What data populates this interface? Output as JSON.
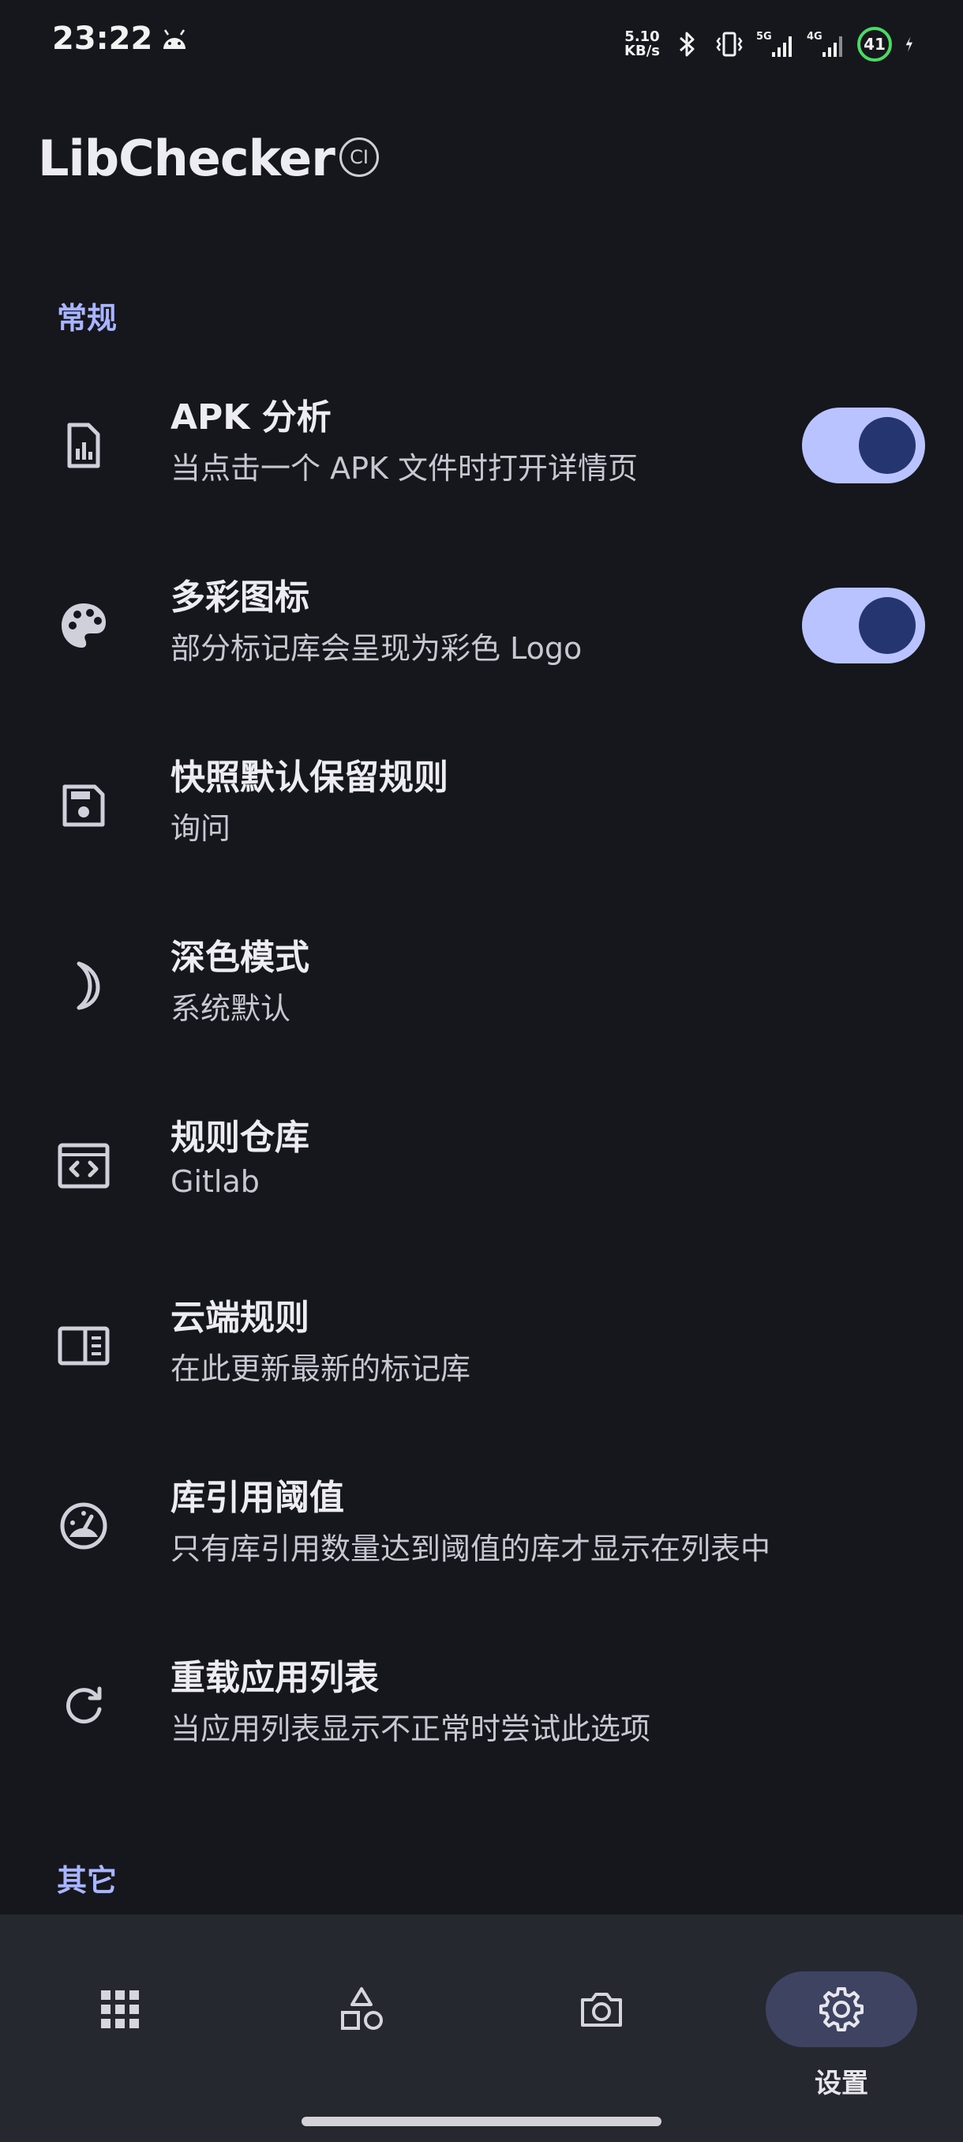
{
  "status_bar": {
    "time": "23:22",
    "net_speed_value": "5.10",
    "net_speed_unit": "KB/s",
    "battery": "41",
    "icons": [
      "android-icon",
      "bluetooth-icon",
      "vibrate-icon",
      "signal-5g-icon",
      "signal-4g-icon",
      "charging-icon"
    ]
  },
  "app_bar": {
    "title": "LibChecker",
    "badge": "CI"
  },
  "sections": {
    "general": "常规",
    "other": "其它"
  },
  "settings": [
    {
      "title": "APK 分析",
      "summary": "当点击一个 APK 文件时打开详情页",
      "icon": "file-chart-icon",
      "toggle": true
    },
    {
      "title": "多彩图标",
      "summary": "部分标记库会呈现为彩色 Logo",
      "icon": "palette-icon",
      "toggle": true
    },
    {
      "title": "快照默认保留规则",
      "summary": "询问",
      "icon": "save-icon"
    },
    {
      "title": "深色模式",
      "summary": "系统默认",
      "icon": "moon-icon"
    },
    {
      "title": "规则仓库",
      "summary": "Gitlab",
      "icon": "code-window-icon"
    },
    {
      "title": "云端规则",
      "summary": "在此更新最新的标记库",
      "icon": "sidebar-panel-icon"
    },
    {
      "title": "库引用阈值",
      "summary": "只有库引用数量达到阈值的库才显示在列表中",
      "icon": "speedometer-icon"
    },
    {
      "title": "重载应用列表",
      "summary": "当应用列表显示不正常时尝试此选项",
      "icon": "refresh-icon"
    }
  ],
  "bottom_nav": {
    "items": [
      {
        "icon": "apps-grid-icon",
        "label": ""
      },
      {
        "icon": "shapes-icon",
        "label": ""
      },
      {
        "icon": "camera-icon",
        "label": ""
      },
      {
        "icon": "gear-icon",
        "label": "设置"
      }
    ],
    "active_index": 3
  },
  "colors": {
    "background": "#16171d",
    "accent": "#a9b6ff",
    "toggle_track": "#b9c3ff",
    "toggle_knob": "#24356f",
    "nav_background": "#262830",
    "nav_active_pill": "#3d4360"
  }
}
